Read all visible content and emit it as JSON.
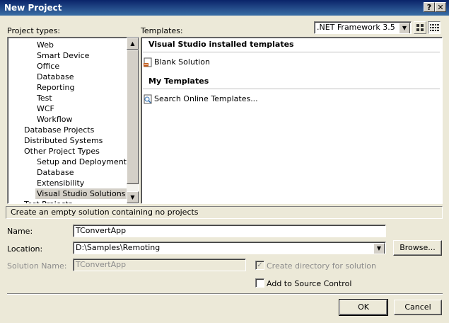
{
  "window": {
    "title": "New Project",
    "help_label": "?",
    "close_label": "✕"
  },
  "project_types": {
    "label": "Project types:",
    "items": [
      {
        "label": "Web",
        "level": 2
      },
      {
        "label": "Smart Device",
        "level": 2
      },
      {
        "label": "Office",
        "level": 2
      },
      {
        "label": "Database",
        "level": 2
      },
      {
        "label": "Reporting",
        "level": 2
      },
      {
        "label": "Test",
        "level": 2
      },
      {
        "label": "WCF",
        "level": 2
      },
      {
        "label": "Workflow",
        "level": 2
      },
      {
        "label": "Database Projects",
        "level": 1
      },
      {
        "label": "Distributed Systems",
        "level": 1
      },
      {
        "label": "Other Project Types",
        "level": 1
      },
      {
        "label": "Setup and Deployment",
        "level": 2
      },
      {
        "label": "Database",
        "level": 2
      },
      {
        "label": "Extensibility",
        "level": 2
      },
      {
        "label": "Visual Studio Solutions",
        "level": 2,
        "selected": true
      },
      {
        "label": "Test Projects",
        "level": 1
      }
    ]
  },
  "templates": {
    "label": "Templates:",
    "framework": ".NET Framework 3.5",
    "installed_header": "Visual Studio installed templates",
    "installed_items": [
      {
        "label": "Blank Solution",
        "icon": "blank-solution-icon"
      }
    ],
    "my_header": "My Templates",
    "my_items": [
      {
        "label": "Search Online Templates...",
        "icon": "search-online-icon"
      }
    ]
  },
  "description": "Create an empty solution containing no projects",
  "form": {
    "name_label": "Name:",
    "name_value": "TConvertApp",
    "location_label": "Location:",
    "location_value": "D:\\Samples\\Remoting",
    "browse_label": "Browse...",
    "solution_name_label": "Solution Name:",
    "solution_name_value": "TConvertApp",
    "create_directory_label": "Create directory for solution",
    "create_directory_checked": true,
    "create_directory_enabled": false,
    "source_control_label": "Add to Source Control",
    "source_control_checked": false
  },
  "buttons": {
    "ok": "OK",
    "cancel": "Cancel"
  }
}
